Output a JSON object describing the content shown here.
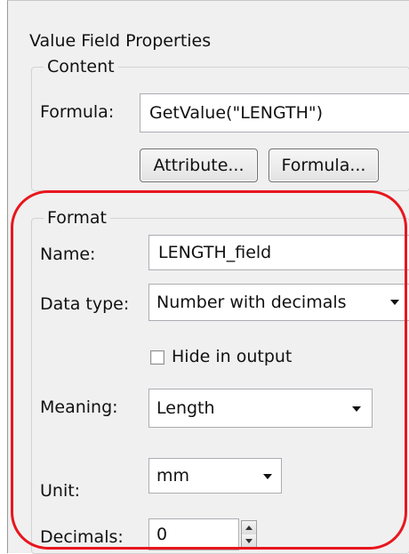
{
  "dialog": {
    "title": "Value Field Properties"
  },
  "content": {
    "legend": "Content",
    "formula_label": "Formula:",
    "formula_value": "GetValue(\"LENGTH\")",
    "attribute_button": "Attribute...",
    "formula_button": "Formula..."
  },
  "format": {
    "legend": "Format",
    "name_label": "Name:",
    "name_value": "LENGTH_field",
    "datatype_label": "Data type:",
    "datatype_value": "Number with decimals",
    "hide_label": "Hide in output",
    "hide_checked": false,
    "meaning_label": "Meaning:",
    "meaning_value": "Length",
    "unit_label": "Unit:",
    "unit_value": "mm",
    "decimals_label": "Decimals:",
    "decimals_value": "0"
  },
  "annotation": {
    "highlight_color": "#e8161d"
  }
}
